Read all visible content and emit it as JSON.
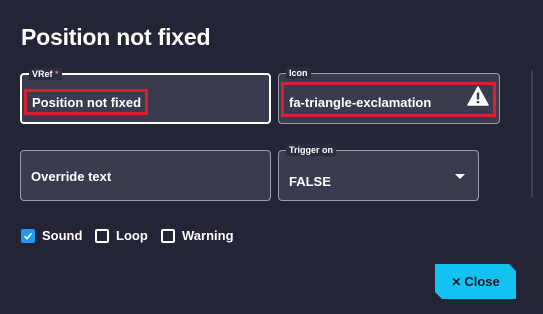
{
  "dialog": {
    "title": "Position not fixed"
  },
  "fields": {
    "vref": {
      "label": "VRef",
      "required_mark": "*",
      "value": "Position not fixed"
    },
    "icon": {
      "label": "Icon",
      "value": "fa-triangle-exclamation",
      "icon": "triangle-exclamation-icon"
    },
    "override": {
      "placeholder": "Override text"
    },
    "trigger": {
      "label": "Trigger on",
      "value": "FALSE"
    }
  },
  "checkboxes": [
    {
      "label": "Sound",
      "checked": true
    },
    {
      "label": "Loop",
      "checked": false
    },
    {
      "label": "Warning",
      "checked": false
    }
  ],
  "buttons": {
    "close": "Close"
  },
  "colors": {
    "accent": "#12c2f0",
    "checkbox": "#2196f3",
    "highlight": "#d9202c",
    "background": "#232435"
  }
}
